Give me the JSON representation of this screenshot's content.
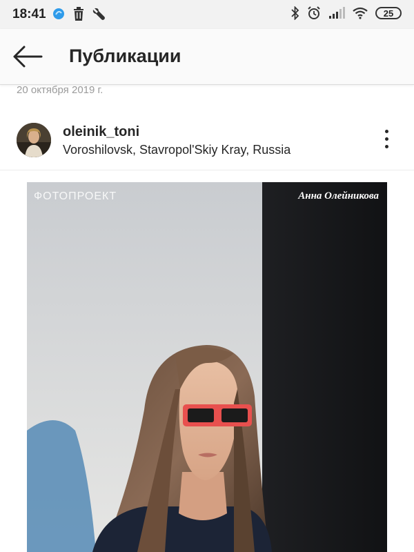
{
  "status_bar": {
    "time": "18:41",
    "battery": "25",
    "left_icons": [
      "app-notification-icon",
      "trash-icon",
      "wrench-icon"
    ],
    "right_icons": [
      "bluetooth-icon",
      "alarm-icon",
      "signal-icon",
      "wifi-icon",
      "battery-icon"
    ]
  },
  "header": {
    "title": "Публикации",
    "back_icon": "arrow-left-icon"
  },
  "post": {
    "date": "20 октября 2019 г.",
    "username": "oleinik_toni",
    "location": "Voroshilovsk, Stavropol'Skiy Kray, Russia",
    "more_icon": "more-vertical-icon",
    "image": {
      "caption_left": "ФОТОПРОЕКТ",
      "caption_right": "Анна Олейникова"
    }
  },
  "colors": {
    "status_bar_bg": "#f2f2f2",
    "header_bg": "#fafafa",
    "text_primary": "#262626",
    "text_secondary": "#9a9a9a",
    "glasses_red": "#e8504e"
  }
}
